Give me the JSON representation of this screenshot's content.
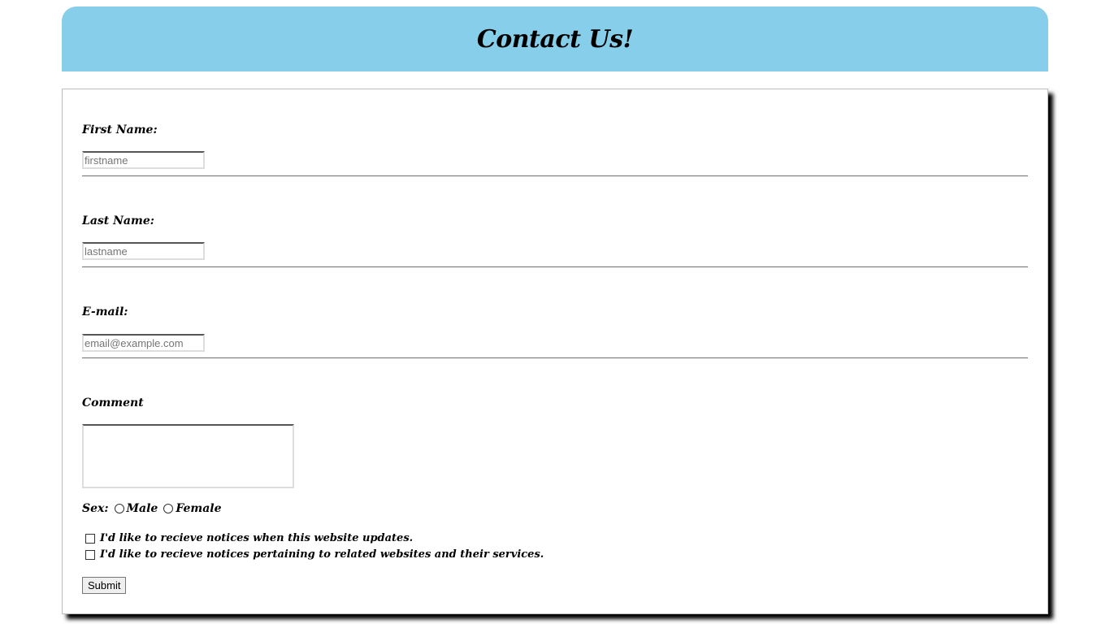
{
  "header": {
    "title": "Contact Us!",
    "background": "#87ceeb"
  },
  "form": {
    "first_name": {
      "label": "First Name:",
      "placeholder": "firstname",
      "value": ""
    },
    "last_name": {
      "label": "Last Name:",
      "placeholder": "lastname",
      "value": ""
    },
    "email": {
      "label": "E-mail:",
      "placeholder": "email@example.com",
      "value": ""
    },
    "comment": {
      "label": "Comment",
      "value": ""
    },
    "sex": {
      "label": "Sex:",
      "options": [
        "Male",
        "Female"
      ],
      "selected": null
    },
    "notices": [
      {
        "label": "I'd like to recieve notices when this website updates.",
        "checked": false
      },
      {
        "label": "I'd like to recieve notices pertaining to related websites and their services.",
        "checked": false
      }
    ],
    "submit_label": "Submit"
  }
}
